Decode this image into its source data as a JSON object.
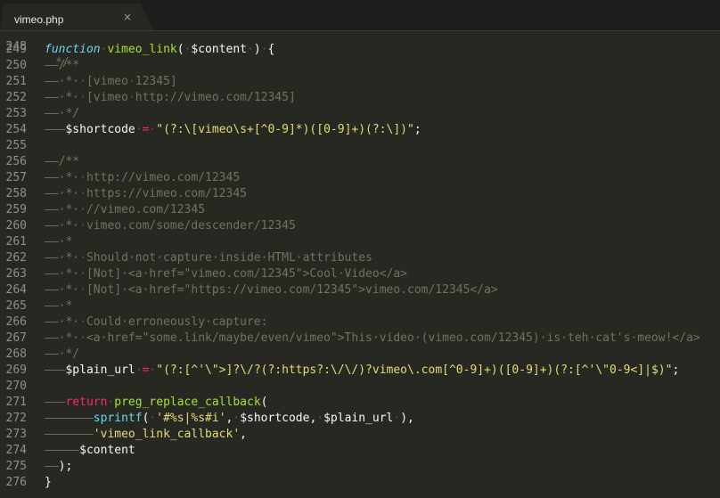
{
  "tab": {
    "title": "vimeo.php",
    "close_glyph": "×"
  },
  "editor": {
    "first_partial_line": {
      "number": "248",
      "text": "*/"
    },
    "lines": [
      {
        "n": "249",
        "segments": [
          [
            "kw",
            "function"
          ],
          [
            "ws",
            "·"
          ],
          [
            "fn",
            "vimeo_link"
          ],
          [
            "var",
            "("
          ],
          [
            "ws",
            "·"
          ],
          [
            "var",
            "$content"
          ],
          [
            "ws",
            "·"
          ],
          [
            "var",
            ")"
          ],
          [
            "ws",
            "·"
          ],
          [
            "var",
            "{"
          ]
        ]
      },
      {
        "n": "250",
        "segments": [
          [
            "ind",
            "——"
          ],
          [
            "cm",
            "/**"
          ]
        ]
      },
      {
        "n": "251",
        "segments": [
          [
            "ind",
            "——"
          ],
          [
            "cm",
            "·*·"
          ],
          [
            "ws",
            "·"
          ],
          [
            "cm",
            "[vimeo"
          ],
          [
            "ws",
            "·"
          ],
          [
            "cm",
            "12345]"
          ]
        ]
      },
      {
        "n": "252",
        "segments": [
          [
            "ind",
            "——"
          ],
          [
            "cm",
            "·*·"
          ],
          [
            "ws",
            "·"
          ],
          [
            "cm",
            "[vimeo"
          ],
          [
            "ws",
            "·"
          ],
          [
            "cm",
            "http://vimeo.com/12345]"
          ]
        ]
      },
      {
        "n": "253",
        "segments": [
          [
            "ind",
            "——"
          ],
          [
            "cm",
            "·*/"
          ]
        ]
      },
      {
        "n": "254",
        "segments": [
          [
            "ind",
            "———"
          ],
          [
            "var",
            "$shortcode"
          ],
          [
            "ws",
            "·"
          ],
          [
            "op",
            "="
          ],
          [
            "ws",
            "·"
          ],
          [
            "str",
            "\"(?:\\[vimeo\\s+[^0-9]*)([0-9]+)(?:\\])\""
          ],
          [
            "var",
            ";"
          ]
        ]
      },
      {
        "n": "255",
        "segments": []
      },
      {
        "n": "256",
        "segments": [
          [
            "ind",
            "——"
          ],
          [
            "cm",
            "/**"
          ]
        ]
      },
      {
        "n": "257",
        "segments": [
          [
            "ind",
            "——"
          ],
          [
            "cm",
            "·*·"
          ],
          [
            "ws",
            "·"
          ],
          [
            "cm",
            "http://vimeo.com/12345"
          ]
        ]
      },
      {
        "n": "258",
        "segments": [
          [
            "ind",
            "——"
          ],
          [
            "cm",
            "·*·"
          ],
          [
            "ws",
            "·"
          ],
          [
            "cm",
            "https://vimeo.com/12345"
          ]
        ]
      },
      {
        "n": "259",
        "segments": [
          [
            "ind",
            "——"
          ],
          [
            "cm",
            "·*·"
          ],
          [
            "ws",
            "·"
          ],
          [
            "cm",
            "//vimeo.com/12345"
          ]
        ]
      },
      {
        "n": "260",
        "segments": [
          [
            "ind",
            "——"
          ],
          [
            "cm",
            "·*·"
          ],
          [
            "ws",
            "·"
          ],
          [
            "cm",
            "vimeo.com/some/descender/12345"
          ]
        ]
      },
      {
        "n": "261",
        "segments": [
          [
            "ind",
            "——"
          ],
          [
            "cm",
            "·*"
          ]
        ]
      },
      {
        "n": "262",
        "segments": [
          [
            "ind",
            "——"
          ],
          [
            "cm",
            "·*·"
          ],
          [
            "ws",
            "·"
          ],
          [
            "cm",
            "Should·not·capture·inside·HTML·attributes"
          ]
        ]
      },
      {
        "n": "263",
        "segments": [
          [
            "ind",
            "——"
          ],
          [
            "cm",
            "·*·"
          ],
          [
            "ws",
            "·"
          ],
          [
            "cm",
            "[Not]·<a·href=\"vimeo.com/12345\">Cool·Video</a>"
          ]
        ]
      },
      {
        "n": "264",
        "segments": [
          [
            "ind",
            "——"
          ],
          [
            "cm",
            "·*·"
          ],
          [
            "ws",
            "·"
          ],
          [
            "cm",
            "[Not]·<a·href=\"https://vimeo.com/12345\">vimeo.com/12345</a>"
          ]
        ]
      },
      {
        "n": "265",
        "segments": [
          [
            "ind",
            "——"
          ],
          [
            "cm",
            "·*"
          ]
        ]
      },
      {
        "n": "266",
        "segments": [
          [
            "ind",
            "——"
          ],
          [
            "cm",
            "·*·"
          ],
          [
            "ws",
            "·"
          ],
          [
            "cm",
            "Could·erroneously·capture:"
          ]
        ]
      },
      {
        "n": "267",
        "segments": [
          [
            "ind",
            "——"
          ],
          [
            "cm",
            "·*·"
          ],
          [
            "ws",
            "·"
          ],
          [
            "cm",
            "<a·href=\"some.link/maybe/even/vimeo\">This·video·(vimeo.com/12345)·is·teh·cat's·meow!</a>"
          ]
        ]
      },
      {
        "n": "268",
        "segments": [
          [
            "ind",
            "——"
          ],
          [
            "cm",
            "·*/"
          ]
        ]
      },
      {
        "n": "269",
        "segments": [
          [
            "ind",
            "———"
          ],
          [
            "var",
            "$plain_url"
          ],
          [
            "ws",
            "·"
          ],
          [
            "op",
            "="
          ],
          [
            "ws",
            "·"
          ],
          [
            "str",
            "\"(?:[^'\\\">]?\\/?(?:https?:\\/\\/)?vimeo\\.com[^0-9]+)([0-9]+)(?:[^'\\\"0-9<]|$)\""
          ],
          [
            "var",
            ";"
          ]
        ]
      },
      {
        "n": "270",
        "segments": []
      },
      {
        "n": "271",
        "segments": [
          [
            "ind",
            "———"
          ],
          [
            "ret",
            "return"
          ],
          [
            "ws",
            "·"
          ],
          [
            "fn",
            "preg_replace_callback"
          ],
          [
            "var",
            "("
          ]
        ]
      },
      {
        "n": "272",
        "segments": [
          [
            "ind",
            "———————"
          ],
          [
            "bltn",
            "sprintf"
          ],
          [
            "var",
            "("
          ],
          [
            "ws",
            "·"
          ],
          [
            "str",
            "'#%s|%s#i'"
          ],
          [
            "var",
            ","
          ],
          [
            "ws",
            "·"
          ],
          [
            "var",
            "$shortcode,"
          ],
          [
            "ws",
            "·"
          ],
          [
            "var",
            "$plain_url"
          ],
          [
            "ws",
            "·"
          ],
          [
            "var",
            "),"
          ]
        ]
      },
      {
        "n": "273",
        "segments": [
          [
            "ind",
            "———————"
          ],
          [
            "str",
            "'vimeo_link_callback'"
          ],
          [
            "var",
            ","
          ]
        ]
      },
      {
        "n": "274",
        "segments": [
          [
            "ind",
            "—————"
          ],
          [
            "var",
            "$content"
          ]
        ]
      },
      {
        "n": "275",
        "segments": [
          [
            "ind",
            "——"
          ],
          [
            "var",
            ");"
          ]
        ]
      },
      {
        "n": "276",
        "segments": [
          [
            "var",
            "}"
          ]
        ]
      }
    ]
  }
}
